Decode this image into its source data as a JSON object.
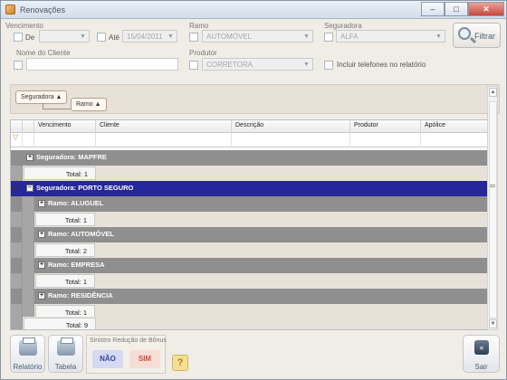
{
  "window": {
    "title": "Renovações",
    "buttons": {
      "minimize": "–",
      "maximize": "□",
      "close": "✕"
    }
  },
  "filters": {
    "vencimento": {
      "label": "Vencimento",
      "de_label": "De",
      "ate_label": "Até",
      "ate_value": "15/04/2011"
    },
    "ramo": {
      "label": "Ramo",
      "value": "AUTOMÓVEL"
    },
    "seguradora": {
      "label": "Seguradora",
      "value": "ALFA"
    },
    "filtrar_label": "Filtrar",
    "nome_cliente": {
      "label": "Nome do Cliente",
      "value": ""
    },
    "produtor": {
      "label": "Produtor",
      "value": "CORRETORA"
    },
    "incluir_telefones_label": "Incluir telefones no relatório"
  },
  "group_by": {
    "chips": [
      "Seguradora",
      "Ramo"
    ]
  },
  "grid": {
    "columns": [
      "Vencimento",
      "Cliente",
      "Descrição",
      "Produtor",
      "Apólice"
    ],
    "rows": [
      {
        "type": "group",
        "level": 0,
        "label": "Seguradora: MAPFRE",
        "expanded": false,
        "selected": false
      },
      {
        "type": "total",
        "level": 0,
        "label": "Total: 1"
      },
      {
        "type": "group",
        "level": 0,
        "label": "Seguradora: PORTO SEGURO",
        "expanded": true,
        "selected": true
      },
      {
        "type": "group",
        "level": 1,
        "label": "Ramo: ALUGUEL",
        "expanded": false,
        "selected": false
      },
      {
        "type": "total",
        "level": 1,
        "label": "Total: 1"
      },
      {
        "type": "group",
        "level": 1,
        "label": "Ramo: AUTOMÓVEL",
        "expanded": false,
        "selected": false
      },
      {
        "type": "total",
        "level": 1,
        "label": "Total: 2"
      },
      {
        "type": "group",
        "level": 1,
        "label": "Ramo: EMPRESA",
        "expanded": false,
        "selected": false
      },
      {
        "type": "total",
        "level": 1,
        "label": "Total: 1"
      },
      {
        "type": "group",
        "level": 1,
        "label": "Ramo: RESIDÊNCIA",
        "expanded": false,
        "selected": false
      },
      {
        "type": "total",
        "level": 1,
        "label": "Total: 1"
      },
      {
        "type": "total",
        "level": 0,
        "label": "Total: 9"
      }
    ]
  },
  "bottom": {
    "relatorio_label": "Relatório",
    "tabela_label": "Tabela",
    "sinistro_title": "Sinistro Redução de Bônus",
    "nao_label": "NÃO",
    "sim_label": "SIM",
    "help_label": "?",
    "sair_label": "Sair"
  },
  "colors": {
    "selected_group": "#26279a",
    "group": "#8f8f8f",
    "nao_bg": "#d5d9f2",
    "sim_bg": "#f7ddd7"
  }
}
